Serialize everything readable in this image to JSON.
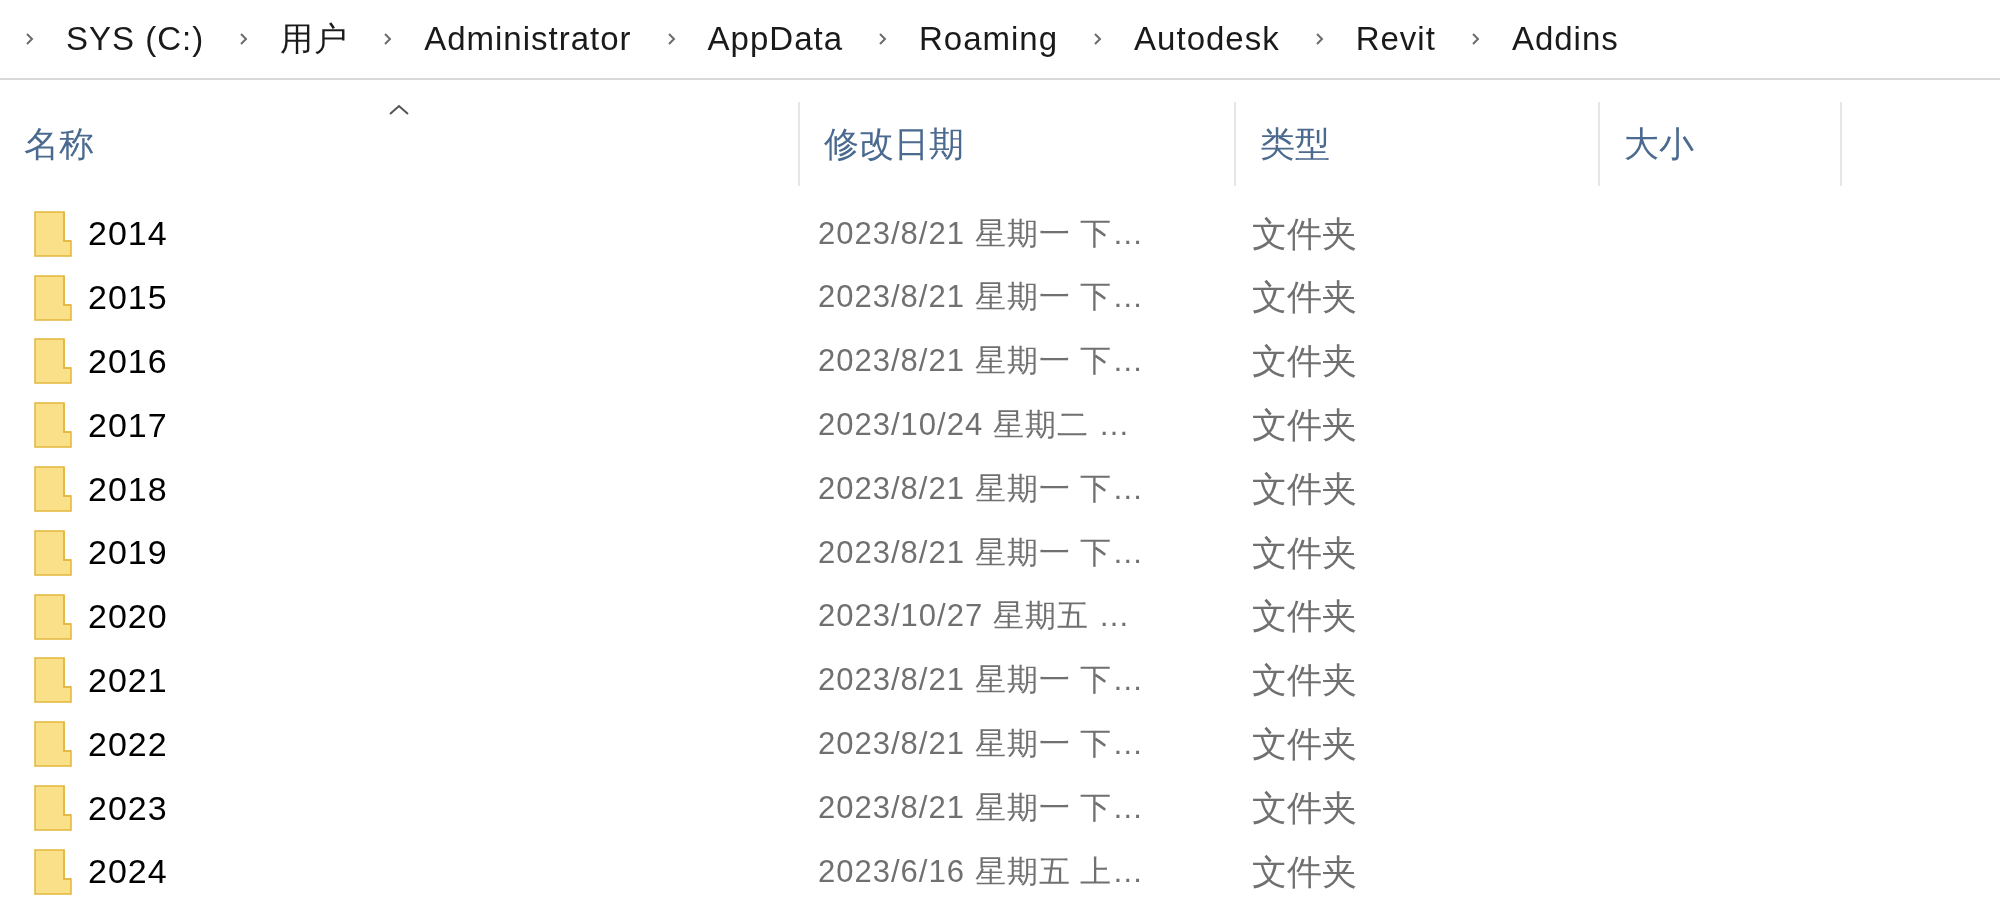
{
  "breadcrumb": [
    "SYS (C:)",
    "用户",
    "Administrator",
    "AppData",
    "Roaming",
    "Autodesk",
    "Revit",
    "Addins"
  ],
  "columns": [
    {
      "label": "名称",
      "sorted": true
    },
    {
      "label": "修改日期",
      "sorted": false
    },
    {
      "label": "类型",
      "sorted": false
    },
    {
      "label": "大小",
      "sorted": false
    }
  ],
  "rows": [
    {
      "name": "2014",
      "modified": "2023/8/21 星期一 下…",
      "type": "文件夹"
    },
    {
      "name": "2015",
      "modified": "2023/8/21 星期一 下…",
      "type": "文件夹"
    },
    {
      "name": "2016",
      "modified": "2023/8/21 星期一 下…",
      "type": "文件夹"
    },
    {
      "name": "2017",
      "modified": "2023/10/24 星期二 …",
      "type": "文件夹"
    },
    {
      "name": "2018",
      "modified": "2023/8/21 星期一 下…",
      "type": "文件夹"
    },
    {
      "name": "2019",
      "modified": "2023/8/21 星期一 下…",
      "type": "文件夹"
    },
    {
      "name": "2020",
      "modified": "2023/10/27 星期五 …",
      "type": "文件夹"
    },
    {
      "name": "2021",
      "modified": "2023/8/21 星期一 下…",
      "type": "文件夹"
    },
    {
      "name": "2022",
      "modified": "2023/8/21 星期一 下…",
      "type": "文件夹"
    },
    {
      "name": "2023",
      "modified": "2023/8/21 星期一 下…",
      "type": "文件夹"
    },
    {
      "name": "2024",
      "modified": "2023/6/16 星期五 上…",
      "type": "文件夹"
    }
  ]
}
